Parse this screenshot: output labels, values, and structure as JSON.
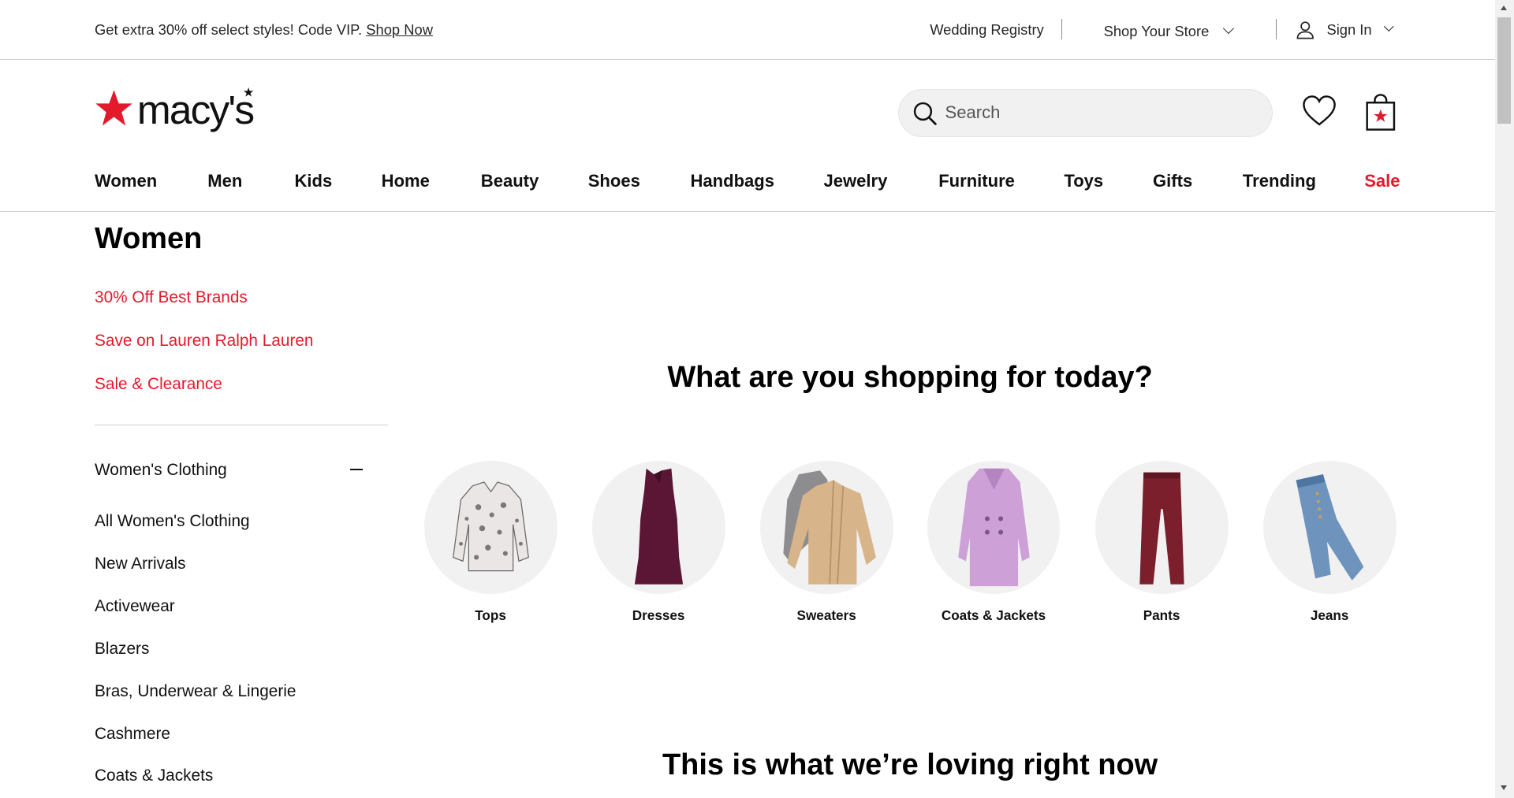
{
  "topbar": {
    "promo_text": "Get extra 30% off select styles! Code VIP.",
    "promo_link": "Shop Now",
    "wedding_registry": "Wedding Registry",
    "shop_your_store": "Shop Your Store",
    "sign_in": "Sign In"
  },
  "header": {
    "logo_text": "macy's",
    "search_placeholder": "Search",
    "brand_color": "#E21A2C"
  },
  "nav": {
    "items": [
      "Women",
      "Men",
      "Kids",
      "Home",
      "Beauty",
      "Shoes",
      "Handbags",
      "Jewelry",
      "Furniture",
      "Toys",
      "Gifts",
      "Trending",
      "Sale"
    ]
  },
  "sidebar": {
    "title": "Women",
    "promos": [
      "30% Off Best Brands",
      "Save on Lauren Ralph Lauren",
      "Sale & Clearance"
    ],
    "section_title": "Women's Clothing",
    "links": [
      "All Women's Clothing",
      "New Arrivals",
      "Activewear",
      "Blazers",
      "Bras, Underwear & Lingerie",
      "Cashmere",
      "Coats & Jackets"
    ]
  },
  "main": {
    "heading": "What are you shopping for today?",
    "categories": [
      {
        "label": "Tops",
        "icon": "blouse-image"
      },
      {
        "label": "Dresses",
        "icon": "dress-image"
      },
      {
        "label": "Sweaters",
        "icon": "cardigan-image"
      },
      {
        "label": "Coats & Jackets",
        "icon": "coat-image"
      },
      {
        "label": "Pants",
        "icon": "pants-image"
      },
      {
        "label": "Jeans",
        "icon": "jeans-image"
      }
    ],
    "subheading": "This is what we’re loving right now"
  }
}
